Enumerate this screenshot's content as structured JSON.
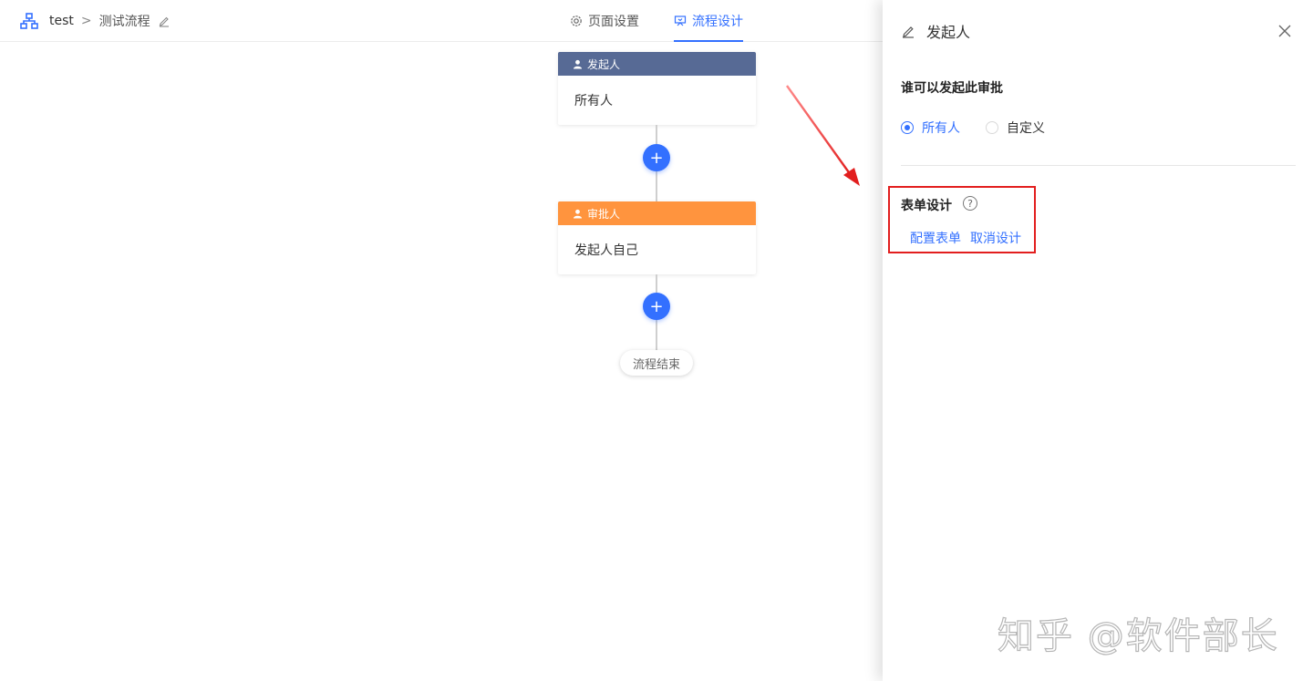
{
  "topbar": {
    "breadcrumb_root": "test",
    "breadcrumb_sep": ">",
    "breadcrumb_current": "测试流程",
    "tabs": [
      {
        "label": "页面设置",
        "icon": "gear-icon",
        "active": false
      },
      {
        "label": "流程设计",
        "icon": "flow-design-icon",
        "active": true
      }
    ]
  },
  "flow": {
    "initiator_node": {
      "header": "发起人",
      "body": "所有人",
      "color": "#576a95"
    },
    "approver_node": {
      "header": "审批人",
      "body": "发起人自己",
      "color": "#ff943e"
    },
    "add_symbol": "+",
    "end_label": "流程结束"
  },
  "drawer": {
    "title": "发起人",
    "who_can_label": "谁可以发起此审批",
    "options": [
      {
        "label": "所有人",
        "checked": true
      },
      {
        "label": "自定义",
        "checked": false
      }
    ],
    "form_design_label": "表单设计",
    "help_symbol": "?",
    "configure_form_link": "配置表单",
    "cancel_design_link": "取消设计"
  },
  "watermark": "知乎 @软件部长",
  "colors": {
    "accent": "#3370ff",
    "annotation_red": "#e21e1e"
  }
}
